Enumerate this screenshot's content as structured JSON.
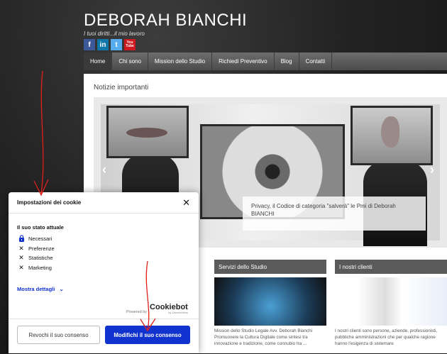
{
  "site": {
    "title": "DEBORAH BIANCHI",
    "tagline": "I tuoi diritti...il mio lavoro",
    "social": [
      "f",
      "in",
      "t",
      "You Tube"
    ],
    "nav": [
      "Home",
      "Chi sono",
      "Mission dello Studio",
      "Richiedi Preventivo",
      "Blog",
      "Contatti"
    ]
  },
  "main": {
    "section_title": "Notizie importanti",
    "slider_caption": "Privacy, il Codice di categoria \"salverà\" le Pmi di Deborah BIANCHI",
    "prev_arrow": "‹",
    "next_arrow": "›",
    "columns": [
      {
        "head": "Servizi dello Studio",
        "text": "Mission dello Studio Legale Avv. Deborah Bianchi Promuovere la Cultura Digitale come sintesi tra innovazione e tradizione, come connubio tra ..."
      },
      {
        "head": "I nostri clienti",
        "text": "I nostri clienti sono persone, aziende, professionisti, pubbliche amministrazioni che per qualche ragione hanno l'esigenza di sistemare"
      }
    ]
  },
  "cookie_dialog": {
    "title": "Impostazioni dei cookie",
    "close": "✕",
    "state_label": "Il suo stato attuale",
    "items": [
      {
        "icon": "lock-icon",
        "label": "Necessari"
      },
      {
        "icon": "x-icon",
        "label": "Preferenze"
      },
      {
        "icon": "x-icon",
        "label": "Statistiche"
      },
      {
        "icon": "x-icon",
        "label": "Marketing"
      }
    ],
    "details_link": "Mostra dettagli",
    "powered_by": "Powered by",
    "brand": "Cookiebot",
    "brand_sub": "by Usercentrics",
    "revoke_button": "Revochi il suo consenso",
    "modify_button": "Modifichi il suo consenso"
  },
  "colors": {
    "accent": "#1032cf",
    "nav": "#5a5a5a",
    "annotation": "#e0201b"
  }
}
